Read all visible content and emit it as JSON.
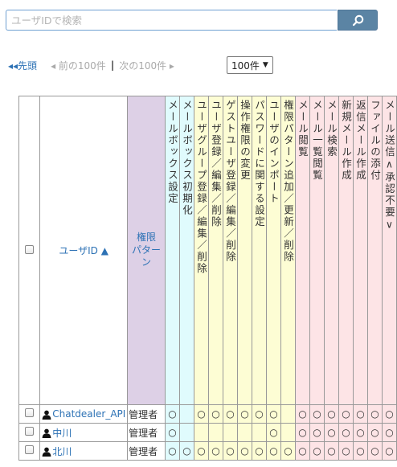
{
  "search": {
    "placeholder": "ユーザIDで検索"
  },
  "pager": {
    "first": "◂◂先頭",
    "prev": "◂ 前の100件",
    "separator": "|",
    "next": "次の100件 ▸",
    "per_page": "100件",
    "per_page_caret": "▼"
  },
  "table": {
    "user_col_label": "ユーザID ▲",
    "role_col_label": "権限\nパターン",
    "permission_columns": [
      {
        "label": "メールボックス設定",
        "color": "#e0fbfd"
      },
      {
        "label": "メールボックス初期化",
        "color": "#e0fbfd"
      },
      {
        "label": "ユーザグループ登録／編集／削除",
        "color": "#fdfdd4"
      },
      {
        "label": "ユーザ登録／編集／削除",
        "color": "#fdfdd4"
      },
      {
        "label": "ゲストユーザ登録／編集／削除",
        "color": "#fdfdd4"
      },
      {
        "label": "操作権限の変更",
        "color": "#fdfdd4"
      },
      {
        "label": "パスワードに関する設定",
        "color": "#fdfdd4"
      },
      {
        "label": "ユーザのインポート",
        "color": "#fdfdd4"
      },
      {
        "label": "権限パターン追加／更新／削除",
        "color": "#fdfdd4"
      },
      {
        "label": "メール閲覧",
        "color": "#fde4e6"
      },
      {
        "label": "メール一覧閲覧",
        "color": "#fde4e6"
      },
      {
        "label": "メール検索",
        "color": "#fde4e6"
      },
      {
        "label": "新規メール作成",
        "color": "#fde4e6"
      },
      {
        "label": "返信メール作成",
        "color": "#fde4e6"
      },
      {
        "label": "ファイルの添付",
        "color": "#fde4e6"
      },
      {
        "label": "メール送信∧承認不要∨",
        "color": "#fde4e6"
      }
    ],
    "rows": [
      {
        "user": "Chatdealer_API",
        "role": "管理者",
        "marks": [
          "○",
          "",
          "○",
          "○",
          "○",
          "○",
          "○",
          "○",
          "",
          "○",
          "○",
          "○",
          "○",
          "○",
          "○",
          "○"
        ]
      },
      {
        "user": "中川",
        "role": "管理者",
        "marks": [
          "○",
          "",
          "",
          "",
          "",
          "",
          "",
          "○",
          "",
          "○",
          "○",
          "○",
          "○",
          "○",
          "○",
          "○"
        ]
      },
      {
        "user": "北川",
        "role": "管理者",
        "marks": [
          "○",
          "○",
          "○",
          "○",
          "○",
          "○",
          "○",
          "○",
          "○",
          "○",
          "○",
          "○",
          "○",
          "○",
          "○",
          "○"
        ]
      }
    ]
  }
}
